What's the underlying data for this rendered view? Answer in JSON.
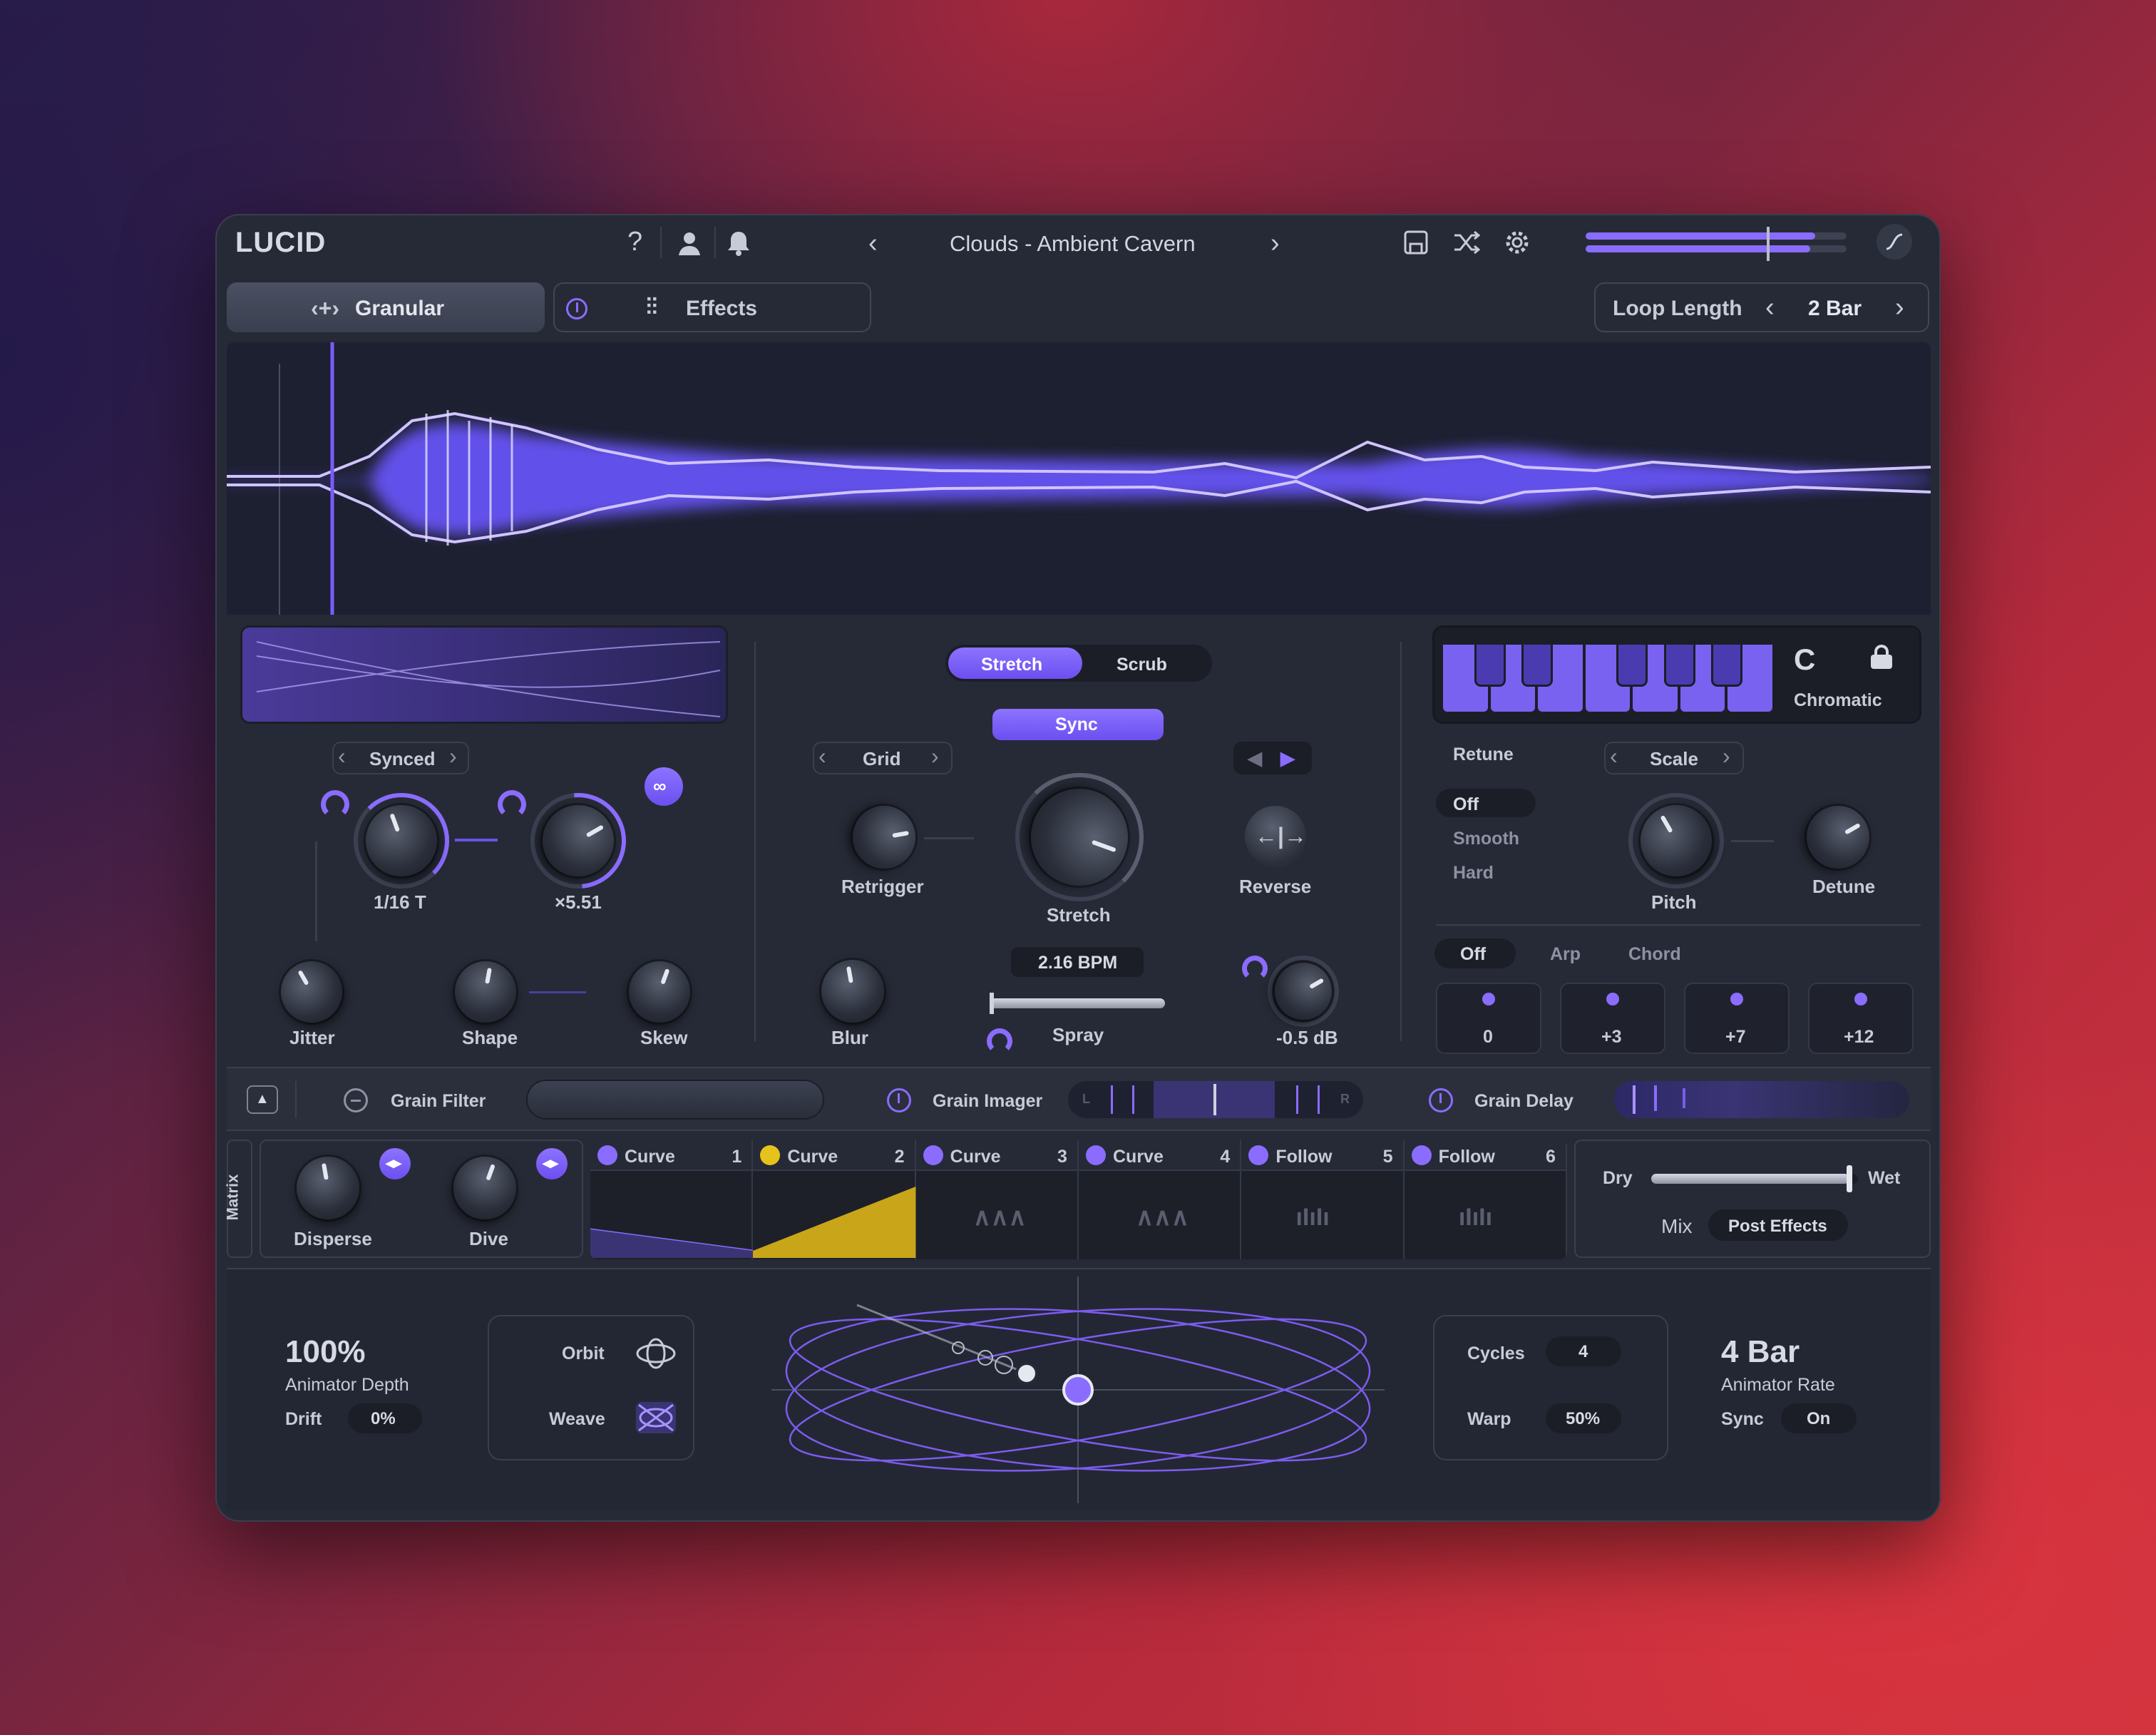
{
  "app": {
    "brand": "LUCID",
    "preset_name": "Clouds - Ambient Cavern"
  },
  "icons": {
    "help": "question-icon",
    "user": "user-icon",
    "bell": "bell-icon",
    "prev": "chevron-left-icon",
    "next": "chevron-right-icon",
    "save": "save-icon",
    "shuffle": "shuffle-icon",
    "settings": "gear-icon",
    "curve": "curve-icon",
    "power": "power-icon",
    "lock": "lock-icon",
    "link": "link-icon",
    "reverse": "reverse-icon",
    "collapse": "arrow-up-icon",
    "minus": "minus-circle-icon",
    "orbit": "orbit-icon",
    "weave": "weave-icon"
  },
  "colors": {
    "accent": "#8a6cff",
    "yellow": "#e6c21c",
    "panel": "#262a36"
  },
  "output_level": 0.88,
  "tabs": {
    "granular": "Granular",
    "effects": "Effects"
  },
  "loop": {
    "label": "Loop Length",
    "value": "2 Bar"
  },
  "grain": {
    "mode": "Synced",
    "rate_value": "1/16 T",
    "mult_value": "×5.51",
    "jitter": "Jitter",
    "shape": "Shape",
    "skew": "Skew"
  },
  "time": {
    "mode_a": "Stretch",
    "mode_b": "Scrub",
    "sync": "Sync",
    "grid": "Grid",
    "retrigger": "Retrigger",
    "stretch": "Stretch",
    "reverse": "Reverse",
    "bpm": "2.16 BPM",
    "blur": "Blur",
    "spray": "Spray",
    "gain": "-0.5 dB"
  },
  "pitch": {
    "key": "C",
    "scale_name": "Chromatic",
    "retune_label": "Retune",
    "scale_label": "Scale",
    "retune_options": [
      "Off",
      "Smooth",
      "Hard"
    ],
    "pitch": "Pitch",
    "detune": "Detune",
    "mode_options": [
      "Off",
      "Arp",
      "Chord"
    ],
    "intervals": [
      "0",
      "+3",
      "+7",
      "+12"
    ]
  },
  "fx": {
    "filter": "Grain Filter",
    "imager": "Grain Imager",
    "delay": "Grain Delay",
    "imager_l": "L",
    "imager_r": "R"
  },
  "matrix": {
    "label": "Matrix",
    "disperse": "Disperse",
    "dive": "Dive",
    "slots": [
      {
        "name": "Curve",
        "num": "1"
      },
      {
        "name": "Curve",
        "num": "2"
      },
      {
        "name": "Curve",
        "num": "3"
      },
      {
        "name": "Curve",
        "num": "4"
      },
      {
        "name": "Follow",
        "num": "5"
      },
      {
        "name": "Follow",
        "num": "6"
      }
    ],
    "dry": "Dry",
    "wet": "Wet",
    "mix": "Mix",
    "mix_mode": "Post Effects",
    "mix_level": 0.96
  },
  "animator": {
    "depth_value": "100%",
    "depth_label": "Animator Depth",
    "drift_label": "Drift",
    "drift_value": "0%",
    "orbit": "Orbit",
    "weave": "Weave",
    "cycles_label": "Cycles",
    "cycles_value": "4",
    "warp_label": "Warp",
    "warp_value": "50%",
    "rate_value": "4 Bar",
    "rate_label": "Animator Rate",
    "sync_label": "Sync",
    "sync_value": "On"
  }
}
